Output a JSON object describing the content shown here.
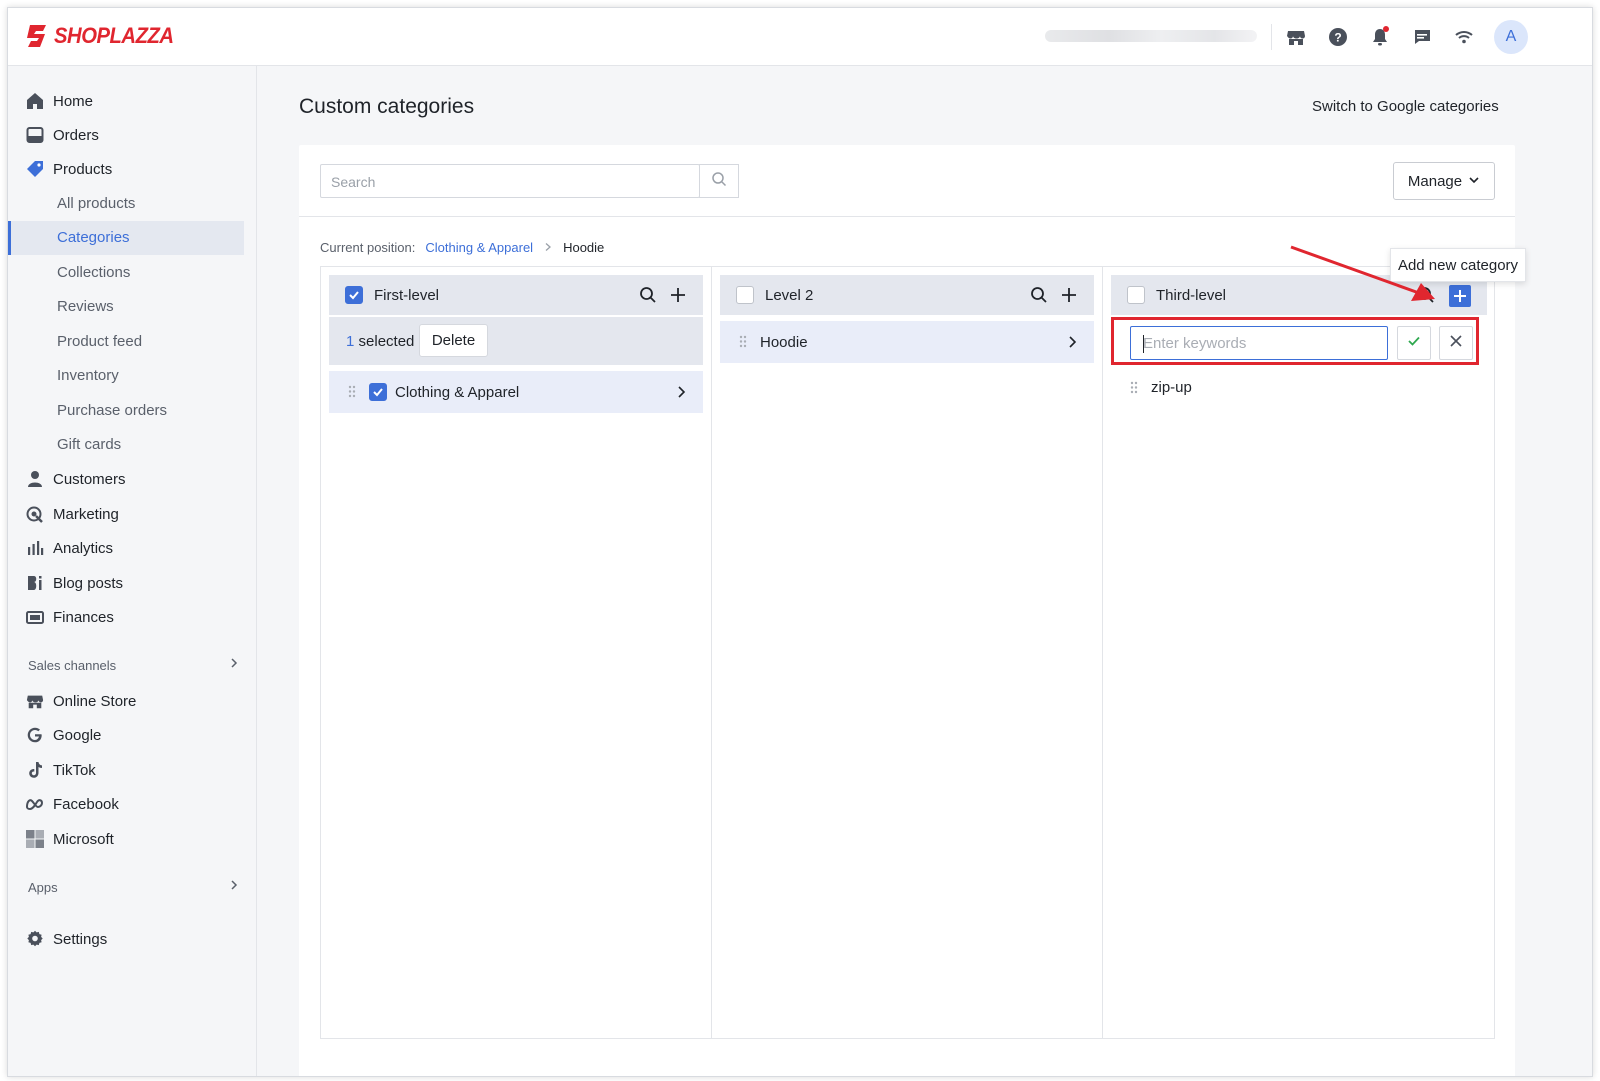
{
  "brand": {
    "name": "SHOPLAZZA",
    "color": "#e0262f"
  },
  "header": {
    "icons": [
      "store-icon",
      "help-icon",
      "bell-icon",
      "message-icon",
      "wifi-icon"
    ],
    "avatar_initial": "A"
  },
  "sidebar": {
    "main": [
      {
        "label": "Home",
        "icon": "home-icon"
      },
      {
        "label": "Orders",
        "icon": "orders-icon"
      },
      {
        "label": "Products",
        "icon": "tag-icon"
      }
    ],
    "product_sub": [
      "All products",
      "Categories",
      "Collections",
      "Reviews",
      "Product feed",
      "Inventory",
      "Purchase orders",
      "Gift cards"
    ],
    "more": [
      {
        "label": "Customers",
        "icon": "person-icon"
      },
      {
        "label": "Marketing",
        "icon": "marketing-icon"
      },
      {
        "label": "Analytics",
        "icon": "analytics-icon"
      },
      {
        "label": "Blog posts",
        "icon": "blog-icon"
      },
      {
        "label": "Finances",
        "icon": "finance-icon"
      }
    ],
    "sales_channels_title": "Sales channels",
    "channels": [
      {
        "label": "Online Store",
        "icon": "store-icon"
      },
      {
        "label": "Google",
        "icon": "google-icon"
      },
      {
        "label": "TikTok",
        "icon": "tiktok-icon"
      },
      {
        "label": "Facebook",
        "icon": "meta-icon"
      },
      {
        "label": "Microsoft",
        "icon": "microsoft-icon"
      }
    ],
    "apps_title": "Apps",
    "settings": "Settings",
    "active_sub": "Categories"
  },
  "page": {
    "title": "Custom categories",
    "switch_link": "Switch to Google categories",
    "search_placeholder": "Search",
    "manage_label": "Manage",
    "breadcrumb": {
      "prefix": "Current position:",
      "link": "Clothing & Apparel",
      "current": "Hoodie"
    }
  },
  "columns": {
    "first": {
      "title": "First-level",
      "selected_count": "1",
      "selected_suffix": "selected",
      "delete_label": "Delete",
      "items": [
        "Clothing & Apparel"
      ]
    },
    "second": {
      "title": "Level 2",
      "items": [
        "Hoodie"
      ]
    },
    "third": {
      "title": "Third-level",
      "keyword_placeholder": "Enter keywords",
      "items": [
        "zip-up"
      ]
    }
  },
  "tooltip": "Add new category",
  "colors": {
    "accent": "#3d6fd8",
    "highlight": "#e0262f"
  }
}
